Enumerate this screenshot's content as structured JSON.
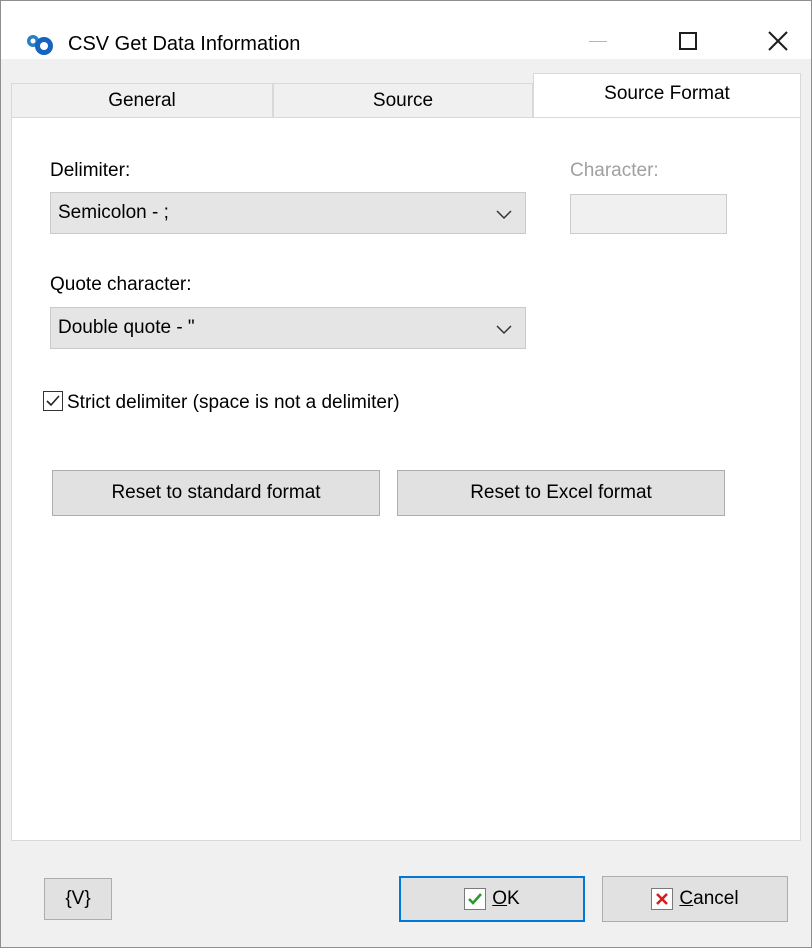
{
  "window": {
    "title": "CSV Get Data Information"
  },
  "tabs": [
    {
      "label": "General",
      "selected": false
    },
    {
      "label": "Source",
      "selected": false
    },
    {
      "label": "Source Format",
      "selected": true
    }
  ],
  "form": {
    "delimiter_label": "Delimiter:",
    "delimiter_value": "Semicolon - ;",
    "character_label": "Character:",
    "character_value": "",
    "quote_label": "Quote character:",
    "quote_value": "Double quote - \"",
    "strict_label": "Strict delimiter (space is not a delimiter)",
    "strict_checked": true,
    "reset_standard_label": "Reset to standard format",
    "reset_excel_label": "Reset to Excel format"
  },
  "footer": {
    "variables_label": "{V}",
    "ok_mnemonic": "O",
    "ok_rest": "K",
    "cancel_mnemonic": "C",
    "cancel_rest": "ancel"
  },
  "colors": {
    "accent": "#0078d7",
    "ok_check": "#2a9a2a",
    "cancel_x": "#d02020"
  },
  "icons": [
    "app-icon",
    "minimize-icon",
    "maximize-icon",
    "close-icon",
    "chevron-down-icon",
    "checkmark-icon",
    "ok-check-icon",
    "cancel-x-icon"
  ]
}
